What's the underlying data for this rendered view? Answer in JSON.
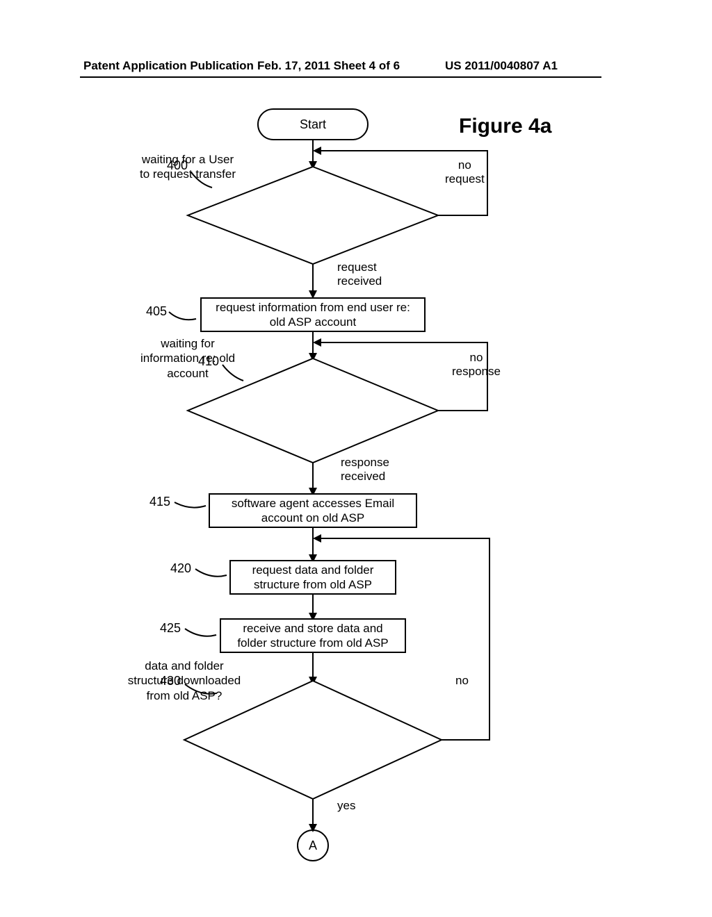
{
  "header": {
    "left": "Patent Application Publication",
    "mid": "Feb. 17, 2011   Sheet 4 of 6",
    "right": "US 2011/0040807 A1"
  },
  "figure_title": "Figure 4a",
  "start_label": "Start",
  "refs": {
    "r400": "400",
    "r405": "405",
    "r410": "410",
    "r415": "415",
    "r420": "420",
    "r425": "425",
    "r430": "430"
  },
  "decisions": {
    "d400": "waiting for a User\nto request transfer",
    "d410": "waiting for\ninformation re: old\naccount",
    "d430": "data and folder\nstructure downloaded\nfrom old ASP?"
  },
  "processes": {
    "p405": "request information from end user re:\nold ASP account",
    "p415": "software agent accesses Email\naccount on old ASP",
    "p420": "request data and folder\nstructure from old ASP",
    "p425": "receive and store data and\nfolder structure from old ASP"
  },
  "edge_labels": {
    "no_request": "no\nrequest",
    "request_received": "request\nreceived",
    "no_response": "no\nresponse",
    "response_received": "response\nreceived",
    "no": "no",
    "yes": "yes"
  },
  "connector": "A"
}
